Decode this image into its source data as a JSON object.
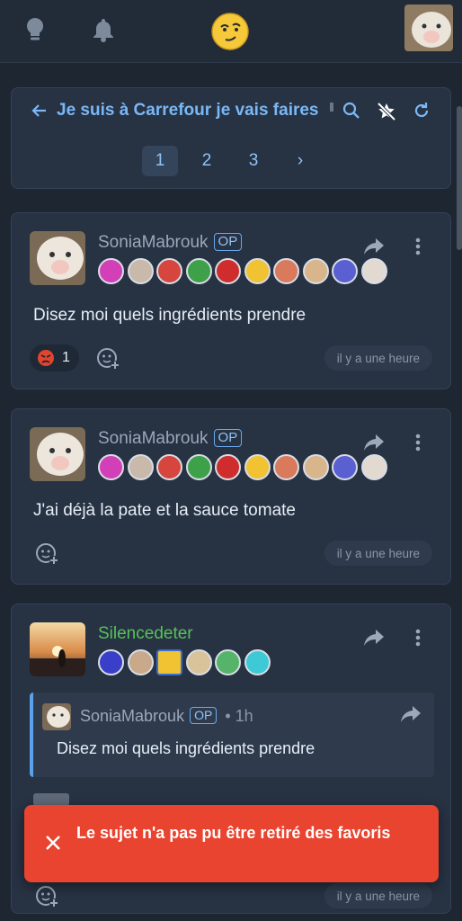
{
  "colors": {
    "background": "#1e2632",
    "card": "#273243",
    "accent": "#7ab8f5",
    "toast": "#e8442f",
    "username_green": "#58c15a"
  },
  "topbar": {
    "icons": [
      "lightbulb-icon",
      "bell-icon",
      "emoji-logo-icon",
      "user-avatar"
    ]
  },
  "topic": {
    "title": "Je suis à Carrefour je vais faires",
    "actions": [
      "search-icon",
      "unstar-icon",
      "refresh-icon"
    ],
    "pages": [
      "1",
      "2",
      "3"
    ],
    "current_page": "1",
    "next_label": "›"
  },
  "posts": [
    {
      "username": "SoniaMabrouk",
      "op": "OP",
      "text": "Disez moi quels ingrédients prendre",
      "reaction_count": "1",
      "time": "il y a une heure"
    },
    {
      "username": "SoniaMabrouk",
      "op": "OP",
      "text": "J'ai déjà la pate et la sauce tomate",
      "time": "il y a une heure"
    },
    {
      "username": "Silencedeter",
      "quote": {
        "username": "SoniaMabrouk",
        "op": "OP",
        "time": "• 1h",
        "text": "Disez moi quels ingrédients prendre"
      },
      "time": "il y a une heure"
    }
  ],
  "toast": {
    "message": "Le sujet n'a pas pu être retiré des favoris"
  }
}
